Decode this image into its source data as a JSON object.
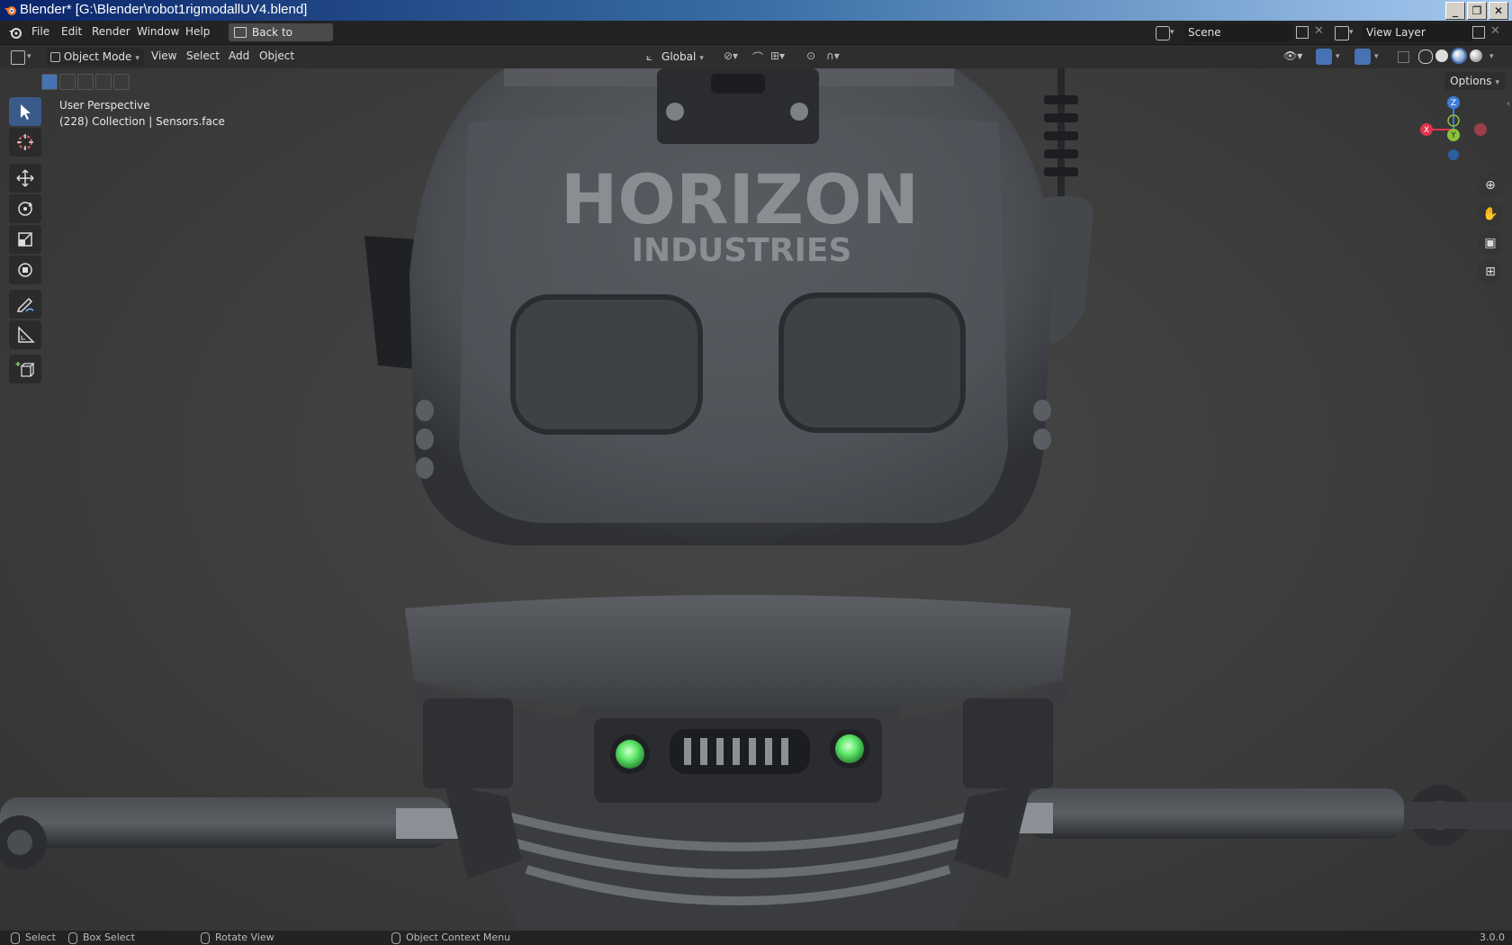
{
  "window": {
    "title": "Blender* [G:\\Blender\\robot1rigmodallUV4.blend]",
    "controls": [
      "_",
      "❐",
      "✕"
    ]
  },
  "topbar": {
    "menus": [
      "File",
      "Edit",
      "Render",
      "Window",
      "Help"
    ],
    "back_button": "Back to Previous",
    "scene_label": "Scene",
    "view_layer_label": "View Layer"
  },
  "header": {
    "mode": "Object Mode",
    "menus": [
      "View",
      "Select",
      "Add",
      "Object"
    ],
    "transform_orientation": "Global",
    "options": "Options"
  },
  "viewport": {
    "perspective": "User Perspective",
    "collection_info": "(228) Collection | Sensors.face",
    "model_logo_line1": "HORIZON",
    "model_logo_line2": "INDUSTRIES",
    "gizmo_axes": {
      "z": "Z",
      "x": "X",
      "y": "Y"
    }
  },
  "tools": [
    {
      "name": "select-box-tool",
      "icon": "cursor-arrow"
    },
    {
      "name": "cursor-tool",
      "icon": "crosshair"
    },
    {
      "name": "move-tool",
      "icon": "move-arrows"
    },
    {
      "name": "rotate-tool",
      "icon": "rotate"
    },
    {
      "name": "scale-tool",
      "icon": "scale"
    },
    {
      "name": "transform-tool",
      "icon": "transform"
    },
    {
      "name": "annotate-tool",
      "icon": "pencil"
    },
    {
      "name": "measure-tool",
      "icon": "ruler"
    },
    {
      "name": "add-cube-tool",
      "icon": "cube-plus"
    }
  ],
  "statusbar": {
    "select": "Select",
    "box_select": "Box Select",
    "rotate_view": "Rotate View",
    "context_menu": "Object Context Menu",
    "version": "3.0.0"
  },
  "colors": {
    "accent_active": "#3b5a89",
    "viewport_bg": "#3d3d3d",
    "gizmo_x": "#e0344c",
    "gizmo_y": "#8bc23a",
    "gizmo_z": "#3b7ed8",
    "robot_led": "#5ee86a"
  }
}
